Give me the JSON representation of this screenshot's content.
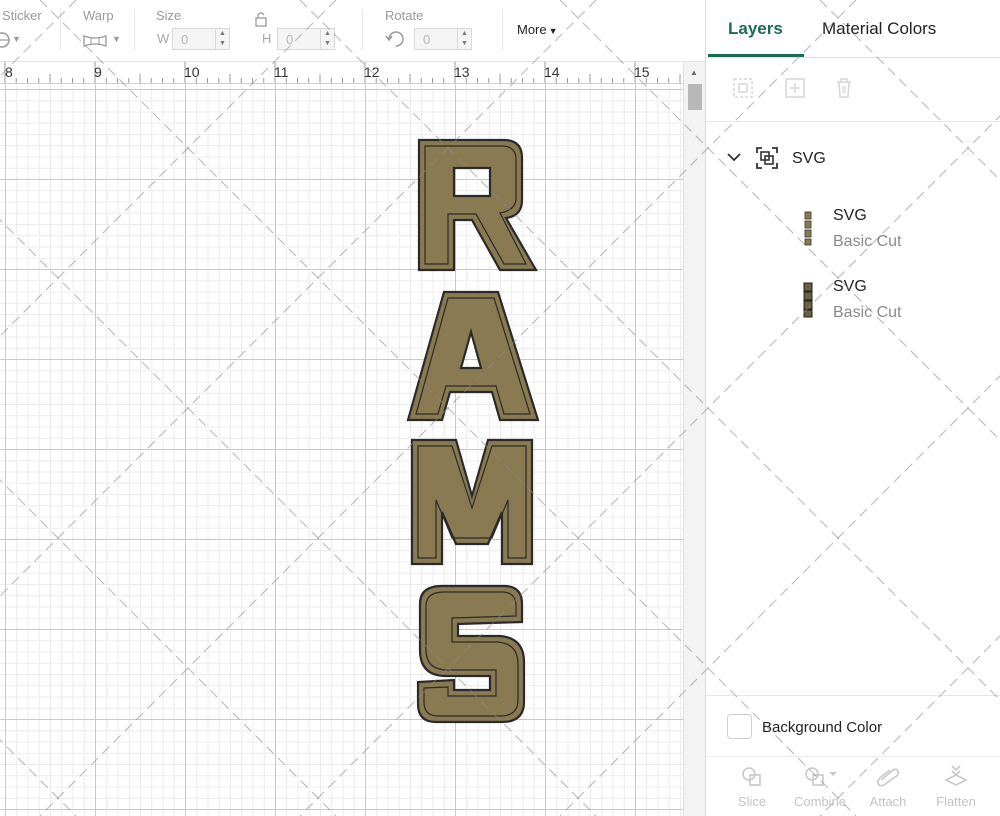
{
  "toolbar": {
    "sticker_label": "Sticker",
    "warp_label": "Warp",
    "size_label": "Size",
    "rotate_label": "Rotate",
    "width_prefix": "W",
    "height_prefix": "H",
    "width_value": "0",
    "height_value": "0",
    "rotate_value": "0",
    "more_label": "More"
  },
  "ruler": {
    "labels": [
      "8",
      "9",
      "10",
      "11",
      "12",
      "13",
      "14",
      "15"
    ]
  },
  "canvas": {
    "artwork_text": "RAMS",
    "artwork_fill_color": "#8a7a52",
    "artwork_outline_color": "#2a2a2a"
  },
  "panel": {
    "tabs": [
      {
        "label": "Layers",
        "active": true
      },
      {
        "label": "Material Colors",
        "active": false
      }
    ],
    "accent_color": "#1a6b53",
    "layer_tool_icons": [
      "group-icon",
      "add-layer-icon",
      "delete-icon"
    ],
    "group": {
      "name": "SVG",
      "expanded": true
    },
    "layers": [
      {
        "name": "SVG",
        "type": "Basic Cut"
      },
      {
        "name": "SVG",
        "type": "Basic Cut"
      }
    ],
    "background_color_label": "Background Color",
    "actions": [
      {
        "label": "Slice",
        "icon": "slice-icon"
      },
      {
        "label": "Combine",
        "icon": "combine-icon"
      },
      {
        "label": "Attach",
        "icon": "attach-icon"
      },
      {
        "label": "Flatten",
        "icon": "flatten-icon"
      }
    ]
  }
}
